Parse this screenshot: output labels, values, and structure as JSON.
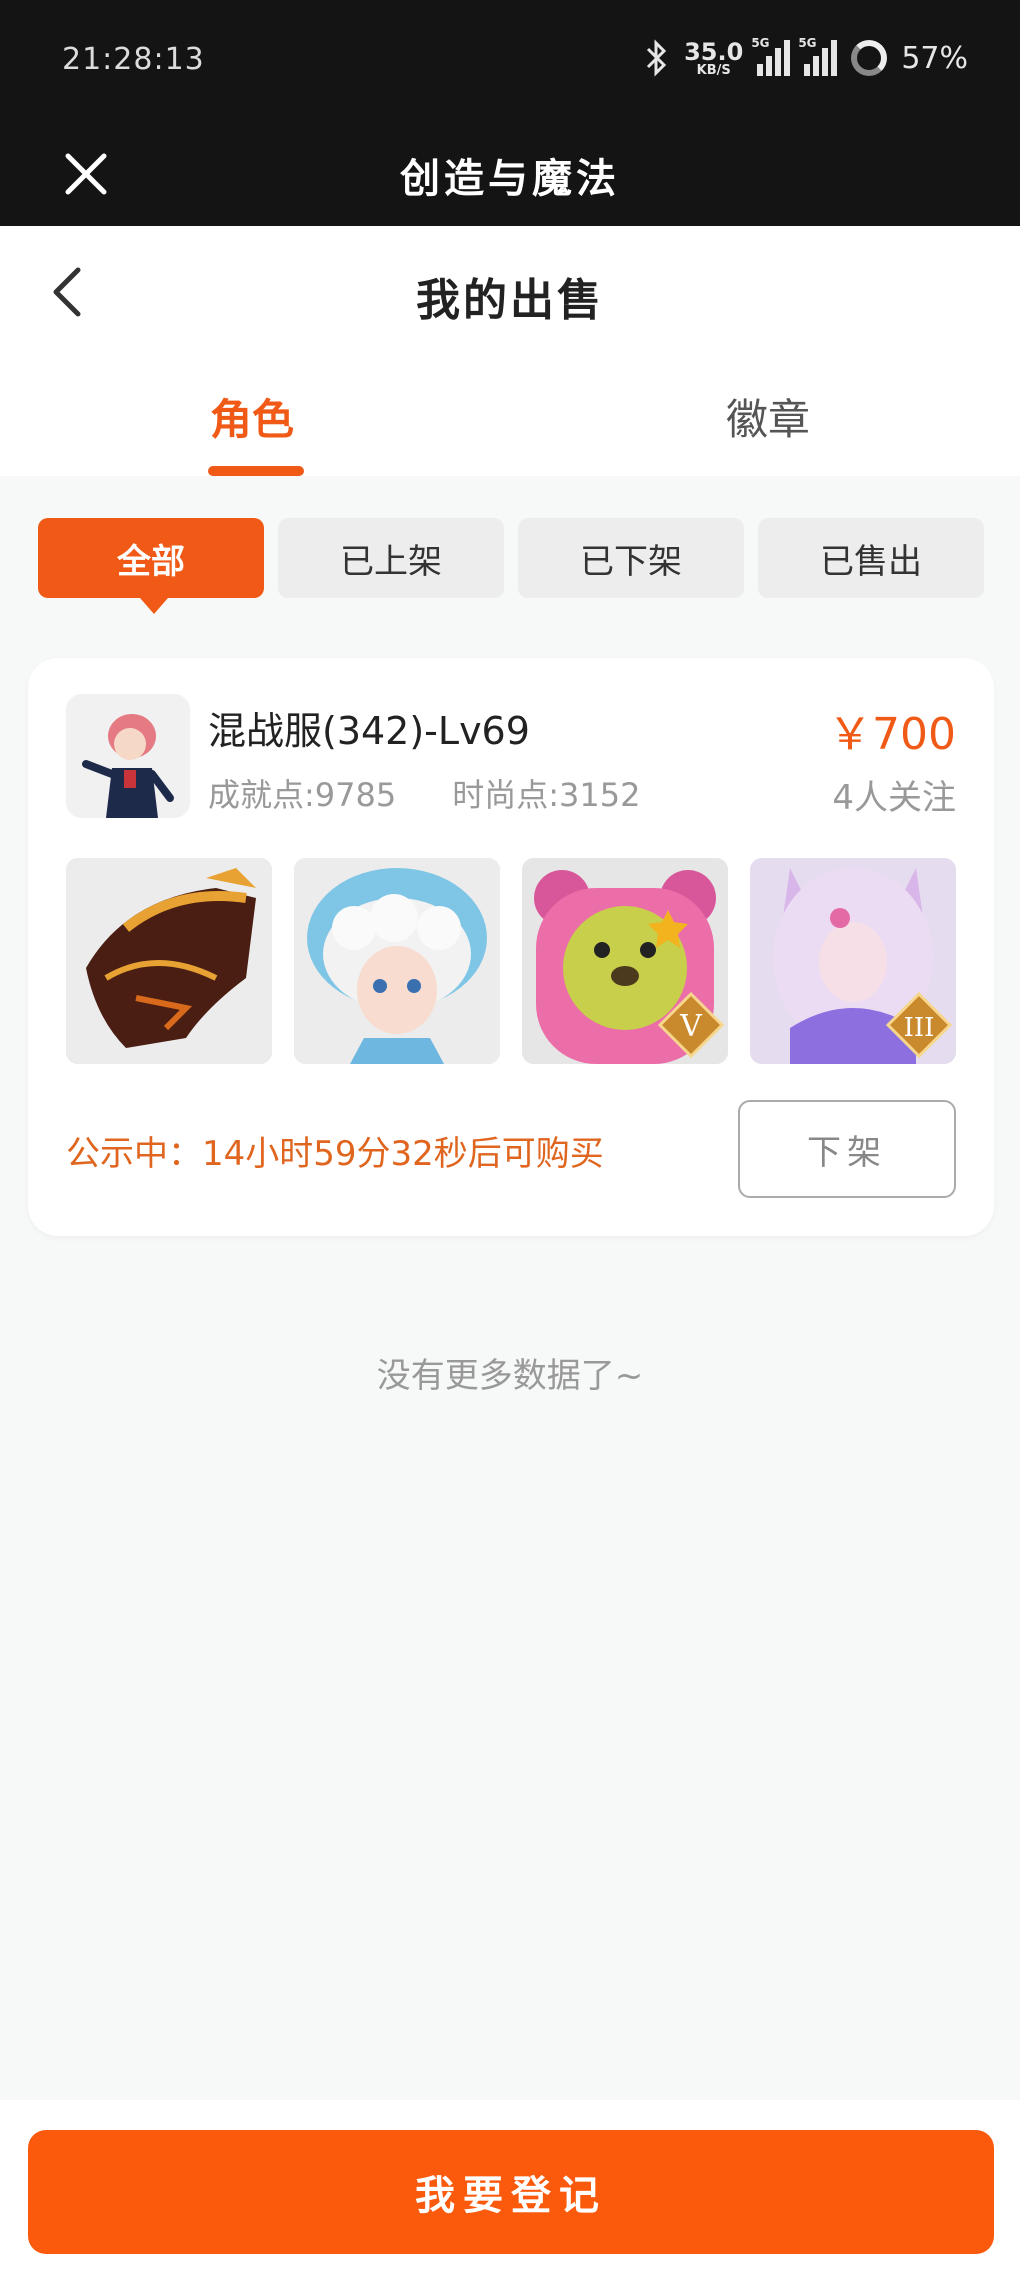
{
  "status_bar": {
    "time": "21:28:13",
    "net_speed": "35.0",
    "net_unit": "KB/S",
    "signal1_label": "5G",
    "signal2_label": "5G",
    "battery": "57%",
    "icons": [
      "bluetooth-icon",
      "signal-icon",
      "battery-icon"
    ]
  },
  "app_bar": {
    "title": "创造与魔法",
    "close_icon": "close-icon"
  },
  "header": {
    "title": "我的出售",
    "back_icon": "chevron-left-icon",
    "tabs": [
      {
        "label": "角色",
        "active": true
      },
      {
        "label": "徽章",
        "active": false
      }
    ]
  },
  "filters": [
    {
      "label": "全部",
      "active": true
    },
    {
      "label": "已上架",
      "active": false
    },
    {
      "label": "已下架",
      "active": false
    },
    {
      "label": "已售出",
      "active": false
    }
  ],
  "listing": {
    "name": "混战服(342)-Lv69",
    "achievement": "成就点:9785",
    "fashion": "时尚点:3152",
    "price": "￥700",
    "followers": "4人关注",
    "thumbnails": [
      "dragon-mount",
      "blue-hair-doll",
      "pink-bear",
      "fox-girl"
    ],
    "badges": [
      "V",
      "III"
    ],
    "notice": "公示中：14小时59分32秒后可购买",
    "offshelf_label": "下架"
  },
  "no_more": "没有更多数据了~",
  "bottom": {
    "register_label": "我要登记"
  },
  "colors": {
    "accent": "#f15a16",
    "button": "#fb5a0c",
    "dark_bar": "#141414"
  }
}
